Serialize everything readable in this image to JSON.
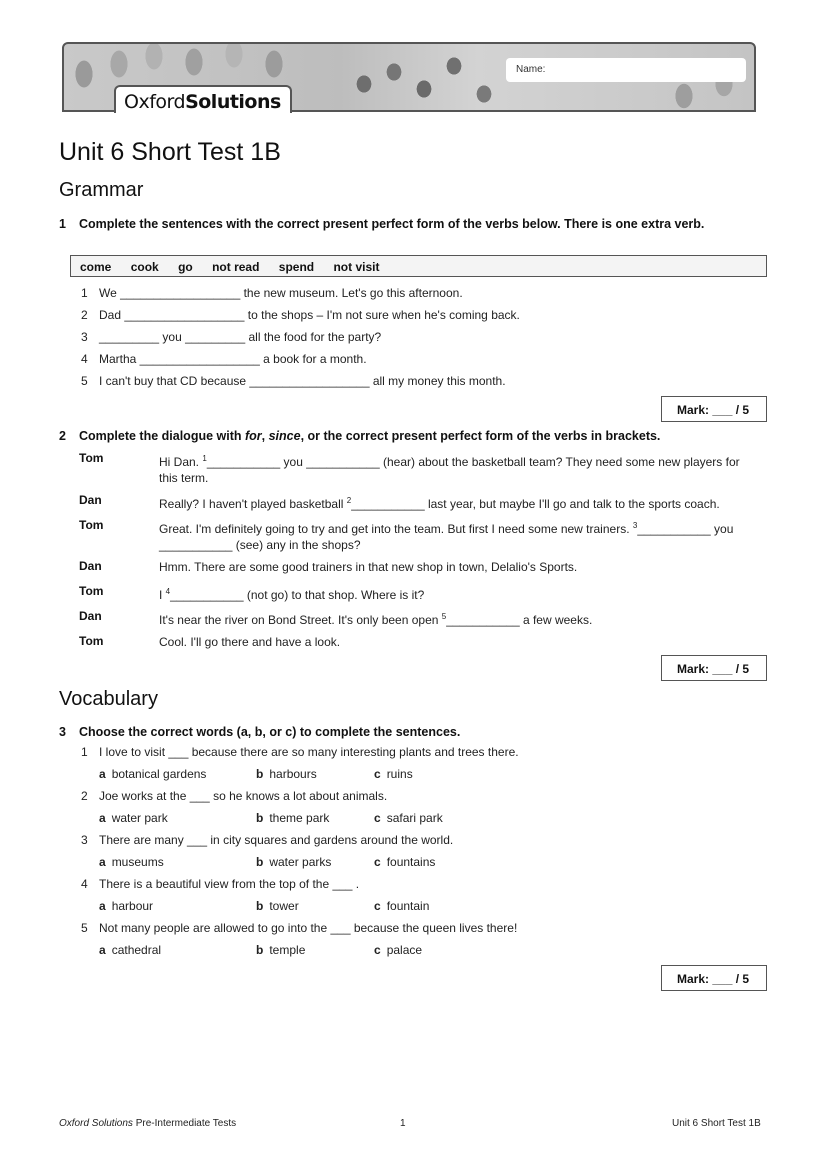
{
  "header": {
    "brand_regular": "Oxford",
    "brand_bold": "Solutions",
    "name_label": "Name:"
  },
  "title": "Unit 6 Short Test 1B",
  "sections": {
    "grammar": "Grammar",
    "vocabulary": "Vocabulary"
  },
  "q1": {
    "number": "1",
    "instruction": "Complete the sentences with the correct present perfect form of the verbs below. There is one extra verb.",
    "words": [
      "come",
      "cook",
      "go",
      "not read",
      "spend",
      "not visit"
    ],
    "items": [
      {
        "n": "1",
        "text": "We __________________ the new museum. Let's go this afternoon."
      },
      {
        "n": "2",
        "text": "Dad __________________ to the shops – I'm not sure when he's coming back."
      },
      {
        "n": "3",
        "text": "_________ you _________ all the food for the party?"
      },
      {
        "n": "4",
        "text": "Martha __________________ a book for a month."
      },
      {
        "n": "5",
        "text": "I can't buy that CD because __________________ all my money this month."
      }
    ],
    "mark": "Mark: ___ / 5"
  },
  "q2": {
    "number": "2",
    "instruction_pre": "Complete the dialogue with ",
    "instruction_for": "for",
    "instruction_comma": ", ",
    "instruction_since": "since",
    "instruction_post": ", or the correct present perfect form of the verbs in brackets.",
    "dialogue": [
      {
        "speaker": "Tom",
        "pre": "Hi Dan. ",
        "sup": "1",
        "post": "___________ you ___________ (hear) about the basketball team? They need some new players for this term."
      },
      {
        "speaker": "Dan",
        "pre": "Really? I haven't played basketball ",
        "sup": "2",
        "post": "___________ last year, but maybe I'll go and talk to the sports coach."
      },
      {
        "speaker": "Tom",
        "pre": "Great. I'm definitely going to try and get into the team. But first I need some new trainers. ",
        "sup": "3",
        "post": "___________ you ___________ (see) any in the shops?"
      },
      {
        "speaker": "Dan",
        "pre": "Hmm. There are some good trainers in that new shop in town, Delalio's Sports.",
        "sup": "",
        "post": ""
      },
      {
        "speaker": "Tom",
        "pre": "I ",
        "sup": "4",
        "post": "___________ (not go) to that shop. Where is it?"
      },
      {
        "speaker": "Dan",
        "pre": "It's near the river on Bond Street. It's only been open ",
        "sup": "5",
        "post": "___________ a few weeks."
      },
      {
        "speaker": "Tom",
        "pre": "Cool. I'll go there and have a look.",
        "sup": "",
        "post": ""
      }
    ],
    "mark": "Mark: ___ / 5"
  },
  "q3": {
    "number": "3",
    "instruction": "Choose the correct words (a, b, or c) to complete the sentences.",
    "items": [
      {
        "n": "1",
        "text": "I love to visit ___ because there are so many interesting plants and trees there.",
        "a": "botanical gardens",
        "b": "harbours",
        "c": "ruins"
      },
      {
        "n": "2",
        "text": "Joe works at the ___ so he knows a lot about animals.",
        "a": "water park",
        "b": "theme park",
        "c": "safari park"
      },
      {
        "n": "3",
        "text": "There are many ___ in city squares and gardens around the world.",
        "a": "museums",
        "b": "water parks",
        "c": "fountains"
      },
      {
        "n": "4",
        "text": "There is a beautiful view from the top of the ___ .",
        "a": "harbour",
        "b": "tower",
        "c": "fountain"
      },
      {
        "n": "5",
        "text": "Not many people are allowed to go into the ___ because the queen lives there!",
        "a": "cathedral",
        "b": "temple",
        "c": "palace"
      }
    ],
    "option_letters": {
      "a": "a",
      "b": "b",
      "c": "c"
    },
    "mark": "Mark: ___ / 5"
  },
  "footer": {
    "brand_italic": "Oxford Solutions",
    "brand_rest": " Pre-Intermediate Tests",
    "page": "1",
    "right": "Unit 6 Short Test 1B"
  }
}
